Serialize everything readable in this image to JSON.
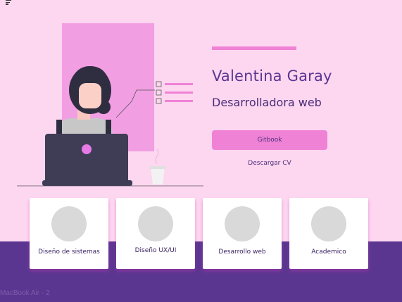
{
  "hero": {
    "name": "Valentina Garay",
    "role": "Desarrolladora web",
    "gitbook_label": "Gitbook",
    "cv_label": "Descargar CV"
  },
  "cards": [
    {
      "label": "Diseño de sistemas"
    },
    {
      "label": "Diseño UX/UI"
    },
    {
      "label": "Desarrollo web"
    },
    {
      "label": "Academico"
    }
  ],
  "frame_label": "MacBook Air - 2",
  "colors": {
    "background": "#fdd6f0",
    "accent": "#f082d6",
    "brand": "#5b3691",
    "card": "#ffffff",
    "placeholder": "#d9d9d9"
  },
  "icons": [
    "menu-icon",
    "avatar-placeholder"
  ]
}
